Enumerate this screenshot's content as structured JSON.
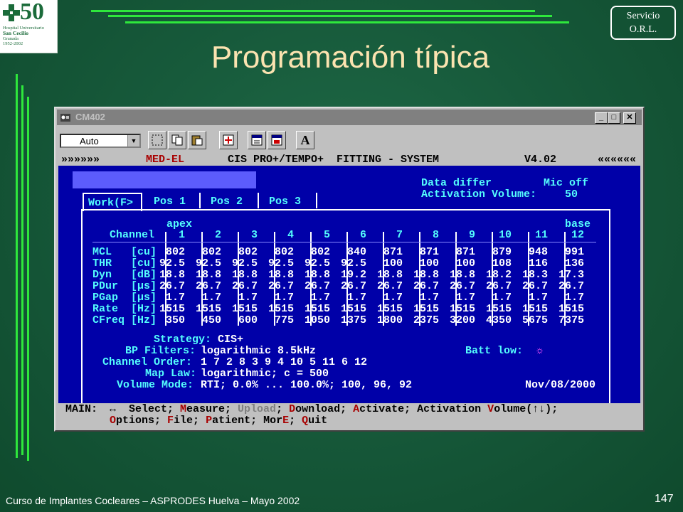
{
  "slide": {
    "title": "Programación típica",
    "footer": "Curso de Implantes Cocleares – ASPRODES Huelva – Mayo 2002",
    "page_number": "147",
    "logo": {
      "number": "50",
      "line1": "Hospital Universitario",
      "line2": "San Cecilio",
      "line3": "Granada",
      "line4": "1952-2002"
    },
    "badge": {
      "line1": "Servicio",
      "line2": "O.R.L."
    }
  },
  "window": {
    "title": "CM402",
    "toolbar": {
      "select_value": "Auto",
      "text_button": "A"
    }
  },
  "app": {
    "header_left": "»»»»»»",
    "header_brand": "MED-EL",
    "header_title": "CIS PRO+/TEMPO+  FITTING - SYSTEM",
    "header_version": "V4.02",
    "header_right": "««««««",
    "status_data_differ": "Data differ",
    "status_mic": "Mic off",
    "activation_label": "Activation Volume:",
    "activation_value": "50",
    "tabs": [
      "Work(F>",
      "Pos 1",
      "Pos 2",
      "Pos 3"
    ],
    "apex_label": "apex",
    "base_label": "base",
    "table": {
      "channel_label": "Channel",
      "channels": [
        "1",
        "2",
        "3",
        "4",
        "5",
        "6",
        "7",
        "8",
        "9",
        "10",
        "11",
        "12"
      ],
      "rows": [
        {
          "name": "MCL",
          "unit": "[cu]",
          "values": [
            "802",
            "802",
            "802",
            "802",
            "802",
            "840",
            "871",
            "871",
            "871",
            "879",
            "948",
            "991"
          ]
        },
        {
          "name": "THR",
          "unit": "[cu]",
          "values": [
            "92.5",
            "92.5",
            "92.5",
            "92.5",
            "92.5",
            "92.5",
            "100",
            "100",
            "100",
            "108",
            "116",
            "136"
          ]
        },
        {
          "name": "Dyn",
          "unit": "[dB]",
          "values": [
            "18.8",
            "18.8",
            "18.8",
            "18.8",
            "18.8",
            "19.2",
            "18.8",
            "18.8",
            "18.8",
            "18.2",
            "18.3",
            "17.3"
          ]
        },
        {
          "name": "PDur",
          "unit": "[µs]",
          "values": [
            "26.7",
            "26.7",
            "26.7",
            "26.7",
            "26.7",
            "26.7",
            "26.7",
            "26.7",
            "26.7",
            "26.7",
            "26.7",
            "26.7"
          ]
        },
        {
          "name": "PGap",
          "unit": "[µs]",
          "values": [
            "1.7",
            "1.7",
            "1.7",
            "1.7",
            "1.7",
            "1.7",
            "1.7",
            "1.7",
            "1.7",
            "1.7",
            "1.7",
            "1.7"
          ]
        },
        {
          "name": "Rate",
          "unit": "[Hz]",
          "values": [
            "1515",
            "1515",
            "1515",
            "1515",
            "1515",
            "1515",
            "1515",
            "1515",
            "1515",
            "1515",
            "1515",
            "1515"
          ]
        },
        {
          "name": "CFreq",
          "unit": "[Hz]",
          "values": [
            "350",
            "450",
            "600",
            "775",
            "1050",
            "1375",
            "1800",
            "2375",
            "3200",
            "4350",
            "5675",
            "7375"
          ]
        }
      ]
    },
    "settings": {
      "strategy_label": "Strategy:",
      "strategy_value": "CIS+",
      "bp_label": "BP Filters:",
      "bp_value": "logarithmic 8.5kHz",
      "batt_label": "Batt low:",
      "batt_value": "☼",
      "order_label": "Channel Order:",
      "order_value": "1 7 2 8 3 9 4 10 5 11 6 12",
      "maplaw_label": "Map Law:",
      "maplaw_value": "logarithmic; c = 500",
      "volume_label": "Volume Mode:",
      "volume_value": "RTI; 0.0% ... 100.0%; 100, 96, 92",
      "date": "Nov/08/2000"
    },
    "menu": {
      "label": "MAIN:",
      "nav": "↔",
      "line1": [
        {
          "key": "",
          "text": " Select; "
        },
        {
          "key": "M",
          "text": "easure; "
        },
        {
          "key": "",
          "text": "Upload",
          "disabled": true
        },
        {
          "key": "",
          "text": "; "
        },
        {
          "key": "D",
          "text": "ownload; "
        },
        {
          "key": "A",
          "text": "ctivate; "
        },
        {
          "key": "",
          "text": "Activation "
        },
        {
          "key": "V",
          "text": "olume(↑↓);"
        }
      ],
      "line2": [
        {
          "key": "O",
          "text": "ptions; "
        },
        {
          "key": "F",
          "text": "ile; "
        },
        {
          "key": "P",
          "text": "atient; "
        },
        {
          "key": "",
          "text": "Mor"
        },
        {
          "key": "E",
          "text": "; "
        },
        {
          "key": "Q",
          "text": "uit"
        }
      ]
    }
  }
}
